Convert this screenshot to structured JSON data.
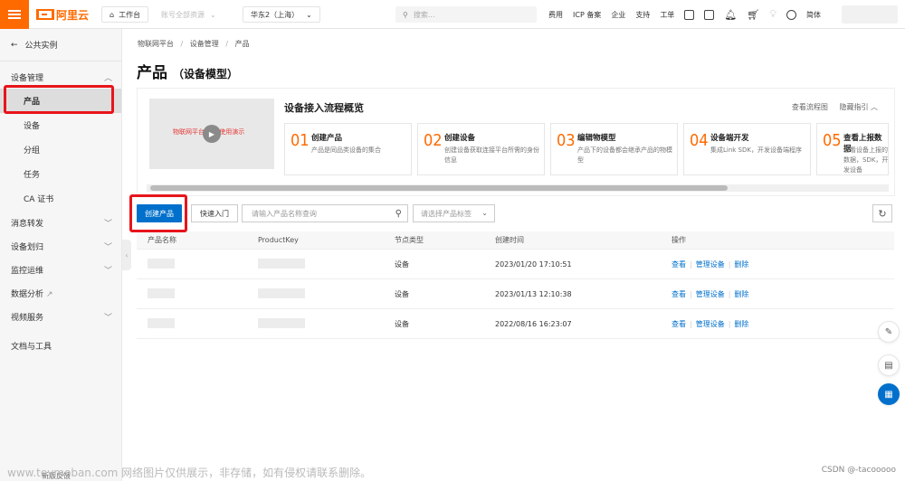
{
  "topbar": {
    "brand": "阿里云",
    "workbench": "工作台",
    "resource_scope": "账号全部资源",
    "region": "华东2（上海）",
    "search_placeholder": "搜索...",
    "nav": [
      "费用",
      "ICP 备案",
      "企业",
      "支持",
      "工单"
    ],
    "lang": "简体"
  },
  "sidebar": {
    "back": "公共实例",
    "groups": [
      {
        "label": "设备管理",
        "items": [
          "产品",
          "设备",
          "分组",
          "任务",
          "CA 证书"
        ]
      },
      {
        "label": "消息转发"
      },
      {
        "label": "设备划归"
      },
      {
        "label": "监控运维"
      },
      {
        "label": "数据分析"
      },
      {
        "label": "视频服务"
      },
      {
        "label": "文档与工具"
      }
    ],
    "active_item": "产品",
    "bottom": "新版反馈"
  },
  "breadcrumb": [
    "物联网平台",
    "设备管理",
    "产品"
  ],
  "page": {
    "title": "产品",
    "subtitle": "（设备模型）"
  },
  "guide": {
    "video_text": "物联网平台 产品使用演示",
    "title": "设备接入流程概览",
    "link_flowchart": "查看流程图",
    "link_hide": "隐藏指引",
    "steps": [
      {
        "num": "01",
        "title": "创建产品",
        "desc": "产品是同品类设备的集合"
      },
      {
        "num": "02",
        "title": "创建设备",
        "desc": "创建设备获取连接平台所需的身份信息"
      },
      {
        "num": "03",
        "title": "编辑物模型",
        "desc": "产品下的设备都会继承产品的物模型"
      },
      {
        "num": "04",
        "title": "设备端开发",
        "desc": "集成Link SDK，开发设备端程序"
      },
      {
        "num": "05",
        "title": "查看上报数据",
        "desc": "查看设备上报的数据，SDK，开发设备"
      }
    ]
  },
  "toolbar": {
    "create_product": "创建产品",
    "quick_start": "快速入门",
    "search_placeholder": "请输入产品名称查询",
    "tag_placeholder": "请选择产品标签"
  },
  "table": {
    "headers": [
      "产品名称",
      "ProductKey",
      "节点类型",
      "创建时间",
      "操作"
    ],
    "rows": [
      {
        "node_type": "设备",
        "created": "2023/01/20 17:10:51"
      },
      {
        "node_type": "设备",
        "created": "2023/01/13 12:10:38"
      },
      {
        "node_type": "设备",
        "created": "2022/08/16 16:23:07"
      }
    ],
    "actions": [
      "查看",
      "管理设备",
      "删除"
    ]
  },
  "watermark": "www.toymoban.com 网络图片仅供展示，非存储，如有侵权请联系删除。",
  "credit": "CSDN @-tacooooo"
}
